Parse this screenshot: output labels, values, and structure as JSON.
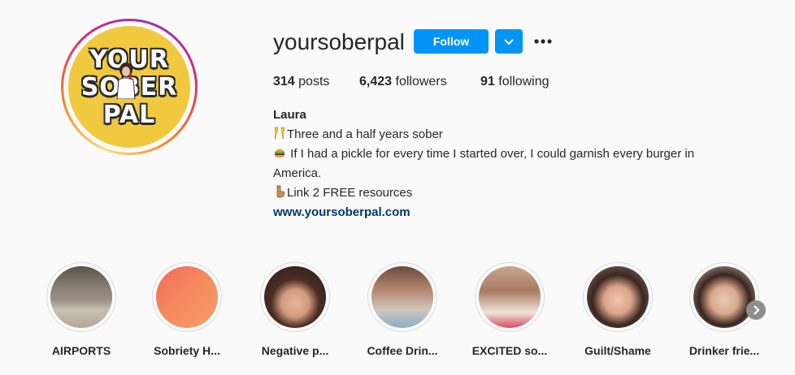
{
  "profile": {
    "username": "yoursoberpal",
    "avatar_logo": [
      "YOUR",
      "SOBER",
      "PAL"
    ],
    "follow_label": "Follow",
    "dropdown_icon": "chevron-down-icon",
    "more_icon": "more-options-icon",
    "stats": {
      "posts_count": "314",
      "posts_label": "posts",
      "followers_count": "6,423",
      "followers_label": "followers",
      "following_count": "91",
      "following_label": "following"
    },
    "bio": {
      "name": "Laura",
      "line1": "Three and a half years sober",
      "line2": " If I had a pickle for every time I started over, I could garnish every burger in America.",
      "line3": "Link 2 FREE resources",
      "link": "www.yoursoberpal.com"
    }
  },
  "highlights": [
    {
      "label": "AIRPORTS"
    },
    {
      "label": "Sobriety H..."
    },
    {
      "label": "Negative p..."
    },
    {
      "label": "Coffee Drin..."
    },
    {
      "label": "EXCITED so..."
    },
    {
      "label": "Guilt/Shame"
    },
    {
      "label": "Drinker frie..."
    }
  ],
  "colors": {
    "accent": "#0095f6",
    "link": "#00376b",
    "background": "#fafafa",
    "avatar_bg": "#f0c93e"
  }
}
